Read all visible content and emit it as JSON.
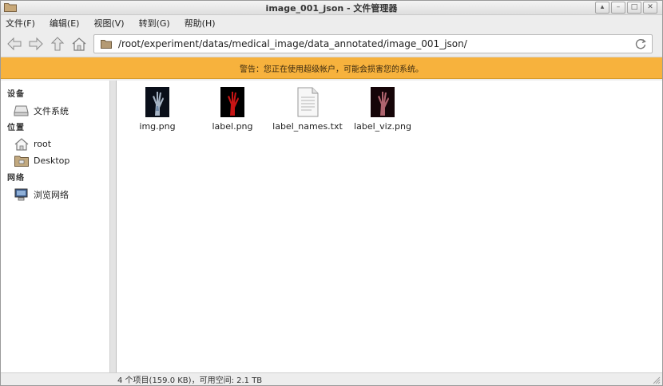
{
  "window": {
    "title": "image_001_json - 文件管理器"
  },
  "menu": [
    {
      "label": "文件(F)"
    },
    {
      "label": "编辑(E)"
    },
    {
      "label": "视图(V)"
    },
    {
      "label": "转到(G)"
    },
    {
      "label": "帮助(H)"
    }
  ],
  "toolbar": {
    "back_icon": "back-arrow-icon",
    "forward_icon": "forward-arrow-icon",
    "up_icon": "up-arrow-icon",
    "home_icon": "home-icon",
    "location": "/root/experiment/datas/medical_image/data_annotated/image_001_json/"
  },
  "warning": "警告：您正在使用超级帐户，可能会损害您的系统。",
  "sidebar": {
    "devices_heading": "设备",
    "devices": [
      {
        "label": "文件系统",
        "icon": "drive-icon"
      }
    ],
    "places_heading": "位置",
    "places": [
      {
        "label": "root",
        "icon": "home-folder-icon"
      },
      {
        "label": "Desktop",
        "icon": "desktop-folder-icon"
      }
    ],
    "network_heading": "网络",
    "network": [
      {
        "label": "浏览网络",
        "icon": "network-icon"
      }
    ]
  },
  "files": [
    {
      "name": "img.png",
      "kind": "xray-thumbnail"
    },
    {
      "name": "label.png",
      "kind": "red-label-thumbnail"
    },
    {
      "name": "label_names.txt",
      "kind": "text-file-icon"
    },
    {
      "name": "label_viz.png",
      "kind": "viz-thumbnail"
    }
  ],
  "status": "4 个项目(159.0 KB)，可用空间: 2.1 TB",
  "colors": {
    "warning_bg": "#f7b23d",
    "accent": "#4a7ab5"
  }
}
